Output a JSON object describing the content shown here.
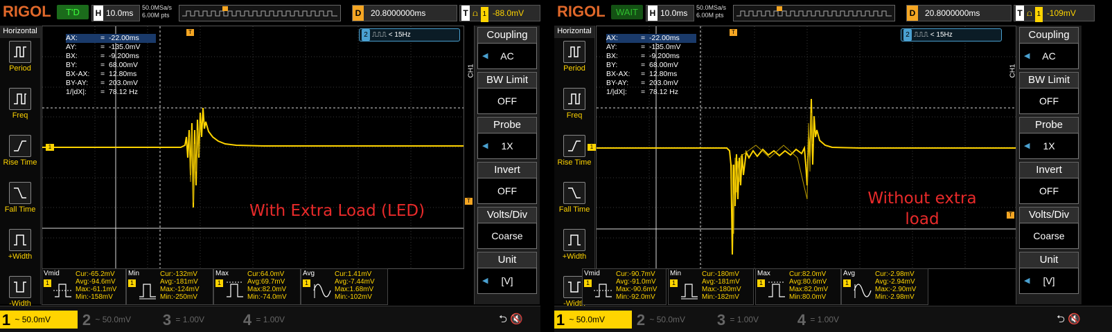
{
  "scopes": [
    {
      "logo": "RIGOL",
      "status": "T'D",
      "horiz_label": "H",
      "timebase": "10.0ms",
      "sample_rate": "50.0MSa/s",
      "mem_depth": "6.00M pts",
      "delay_label": "D",
      "delay": "20.8000000ms",
      "trig_label": "T",
      "trig_channel": "1",
      "trig_level": "-88.0mV",
      "sidebar": {
        "title": "Horizontal",
        "items": [
          "Period",
          "Freq",
          "Rise Time",
          "Fall Time",
          "+Width",
          "-Width"
        ]
      },
      "cursor": {
        "rows": [
          {
            "k": "AX:",
            "v": "-22.00ms"
          },
          {
            "k": "AY:",
            "v": "-135.0mV"
          },
          {
            "k": "BX:",
            "v": "-9.200ms"
          },
          {
            "k": "BY:",
            "v": "68.00mV"
          },
          {
            "k": "BX-AX:",
            "v": "12.80ms"
          },
          {
            "k": "BY-AY:",
            "v": "203.0mV"
          },
          {
            "k": "1/|dX|:",
            "v": "78.12 Hz"
          }
        ]
      },
      "trig_source": {
        "channel": "2",
        "text": "< 15Hz"
      },
      "annotation": "With Extra Load (LED)",
      "measurements": [
        {
          "name": "Vmid",
          "ch": "1",
          "lines": [
            "Cur:-65.2mV",
            "Avg:-94.6mV",
            "Max:-61.1mV",
            "Min:-158mV"
          ]
        },
        {
          "name": "Min",
          "ch": "1",
          "lines": [
            "Cur:-132mV",
            "Avg:-181mV",
            "Max:-124mV",
            "Min:-250mV"
          ]
        },
        {
          "name": "Max",
          "ch": "1",
          "lines": [
            "Cur:64.0mV",
            "Avg:69.7mV",
            "Max:82.0mV",
            "Min:-74.0mV"
          ]
        },
        {
          "name": "Avg",
          "ch": "1",
          "lines": [
            "Cur:1.41mV",
            "Avg:-7.44mV",
            "Max:1.68mV",
            "Min:-102mV"
          ]
        }
      ],
      "menu": {
        "ch_label": "CH1",
        "items": [
          {
            "title": "Coupling",
            "value": "AC"
          },
          {
            "title": "BW Limit",
            "value": "OFF"
          },
          {
            "title": "Probe",
            "value": "1X"
          },
          {
            "title": "Invert",
            "value": "OFF"
          },
          {
            "title": "Volts/Div",
            "value": "Coarse"
          },
          {
            "title": "Unit",
            "value": "[V]"
          }
        ]
      },
      "channels": [
        {
          "n": "1",
          "v": "50.0mV"
        },
        {
          "n": "2",
          "v": "50.0mV"
        },
        {
          "n": "3",
          "v": "1.00V"
        },
        {
          "n": "4",
          "v": "1.00V"
        }
      ],
      "marker_ch": "1",
      "marker_t": "T"
    },
    {
      "logo": "RIGOL",
      "status": "WAIT",
      "horiz_label": "H",
      "timebase": "10.0ms",
      "sample_rate": "50.0MSa/s",
      "mem_depth": "6.00M pts",
      "delay_label": "D",
      "delay": "20.8000000ms",
      "trig_label": "T",
      "trig_channel": "1",
      "trig_level": "-109mV",
      "sidebar": {
        "title": "Horizontal",
        "items": [
          "Period",
          "Freq",
          "Rise Time",
          "Fall Time",
          "+Width",
          "-Width"
        ]
      },
      "cursor": {
        "rows": [
          {
            "k": "AX:",
            "v": "-22.00ms"
          },
          {
            "k": "AY:",
            "v": "-135.0mV"
          },
          {
            "k": "BX:",
            "v": "-9.200ms"
          },
          {
            "k": "BY:",
            "v": "68.00mV"
          },
          {
            "k": "BX-AX:",
            "v": "12.80ms"
          },
          {
            "k": "BY-AY:",
            "v": "203.0mV"
          },
          {
            "k": "1/|dX|:",
            "v": "78.12 Hz"
          }
        ]
      },
      "trig_source": {
        "channel": "2",
        "text": "< 15Hz"
      },
      "annotation": "Without extra load",
      "measurements": [
        {
          "name": "Vmid",
          "ch": "1",
          "lines": [
            "Cur:-90.7mV",
            "Avg:-91.0mV",
            "Max:-90.6mV",
            "Min:-92.0mV"
          ]
        },
        {
          "name": "Min",
          "ch": "1",
          "lines": [
            "Cur:-180mV",
            "Avg:-181mV",
            "Max:-180mV",
            "Min:-182mV"
          ]
        },
        {
          "name": "Max",
          "ch": "1",
          "lines": [
            "Cur:82.0mV",
            "Avg:80.6mV",
            "Max:82.0mV",
            "Min:80.0mV"
          ]
        },
        {
          "name": "Avg",
          "ch": "1",
          "lines": [
            "Cur:-2.98mV",
            "Avg:-2.94mV",
            "Max:-2.90mV",
            "Min:-2.98mV"
          ]
        }
      ],
      "menu": {
        "ch_label": "CH1",
        "items": [
          {
            "title": "Coupling",
            "value": "AC"
          },
          {
            "title": "BW Limit",
            "value": "OFF"
          },
          {
            "title": "Probe",
            "value": "1X"
          },
          {
            "title": "Invert",
            "value": "OFF"
          },
          {
            "title": "Volts/Div",
            "value": "Coarse"
          },
          {
            "title": "Unit",
            "value": "[V]"
          }
        ]
      },
      "channels": [
        {
          "n": "1",
          "v": "50.0mV"
        },
        {
          "n": "2",
          "v": "50.0mV"
        },
        {
          "n": "3",
          "v": "1.00V"
        },
        {
          "n": "4",
          "v": "1.00V"
        }
      ],
      "marker_ch": "1",
      "marker_t": "T"
    }
  ],
  "colors": {
    "trace": "#ffd400",
    "logo": "#e0682a",
    "annotation": "#e82a2a",
    "accent": "#4aa0d0"
  }
}
